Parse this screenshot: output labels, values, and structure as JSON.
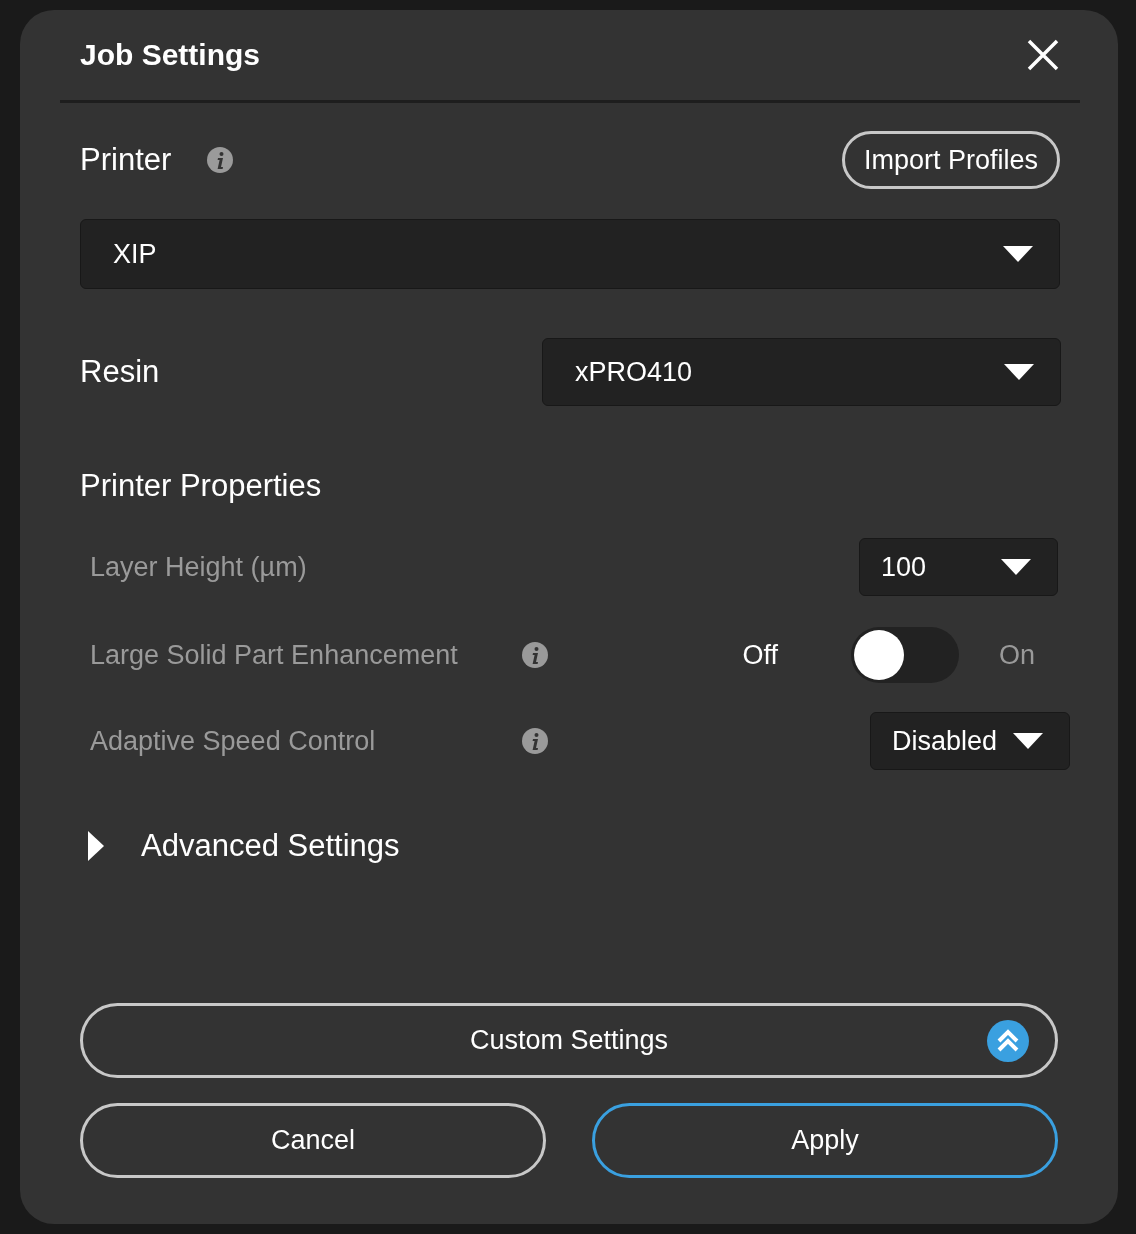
{
  "dialog": {
    "title": "Job Settings"
  },
  "printer": {
    "label": "Printer",
    "info": true,
    "import_button": "Import Profiles",
    "value": "XIP"
  },
  "resin": {
    "label": "Resin",
    "value": "xPRO410"
  },
  "properties": {
    "heading": "Printer Properties",
    "rows": [
      {
        "kind": "select",
        "label": "Layer Height (µm)",
        "info": false,
        "value": "100"
      },
      {
        "kind": "toggle",
        "label": "Large Solid Part Enhancement",
        "info": true,
        "off_label": "Off",
        "on_label": "On",
        "on": false
      },
      {
        "kind": "select",
        "label": "Adaptive Speed Control",
        "info": true,
        "value": "Disabled"
      }
    ]
  },
  "advanced": {
    "label": "Advanced Settings",
    "expanded": false
  },
  "custom_button": "Custom Settings",
  "buttons": [
    {
      "label": "Cancel",
      "primary": false
    },
    {
      "label": "Apply",
      "primary": true
    }
  ]
}
